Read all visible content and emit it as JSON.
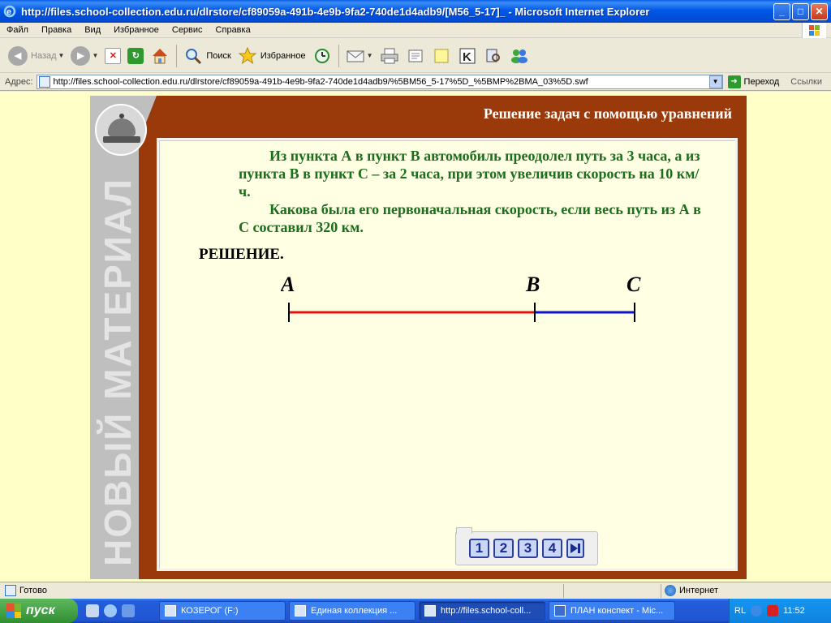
{
  "window": {
    "title": "http://files.school-collection.edu.ru/dlrstore/cf89059a-491b-4e9b-9fa2-740de1d4adb9/[M56_5-17]_ - Microsoft Internet Explorer",
    "buttons": {
      "minimize": "_",
      "maximize": "□",
      "close": "✕"
    }
  },
  "menu": [
    "Файл",
    "Правка",
    "Вид",
    "Избранное",
    "Сервис",
    "Справка"
  ],
  "toolbar": {
    "back": "Назад",
    "search": "Поиск",
    "favorites": "Избранное"
  },
  "address": {
    "label": "Адрес:",
    "url": "http://files.school-collection.edu.ru/dlrstore/cf89059a-491b-4e9b-9fa2-740de1d4adb9/%5BM56_5-17%5D_%5BMP%2BMA_03%5D.swf",
    "go": "Переход",
    "links": "Ссылки"
  },
  "flash": {
    "header": "Решение задач с помощью уравнений",
    "side_label": "НОВЫЙ МАТЕРИАЛ",
    "problem": [
      "Из пункта А в пункт  В автомобиль преодолел путь за 3 часа, а из пункта В в пункт С – за 2 часа, при этом увеличив скорость на 10 км/ч.",
      "Какова была его первоначальная скорость, если весь путь из А в С составил 320 км."
    ],
    "solution_label": "РЕШЕНИЕ.",
    "points": [
      "A",
      "B",
      "C"
    ],
    "colors": {
      "segment_ab": "#E81010",
      "segment_bc": "#1010D0",
      "text": "#1B6E1B",
      "frame": "#9A3A0A"
    },
    "pager": [
      "1",
      "2",
      "3",
      "4"
    ]
  },
  "status": {
    "text": "Готово",
    "zone": "Интернет"
  },
  "taskbar": {
    "start": "пуск",
    "tasks": [
      "КОЗЕРОГ (F:)",
      "Единая коллекция ...",
      "http://files.school-coll...",
      "ПЛАН конспект - Mic..."
    ],
    "lang": "RL",
    "clock": "11:52"
  }
}
